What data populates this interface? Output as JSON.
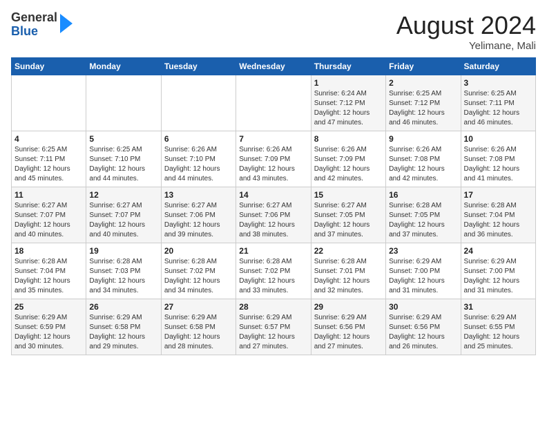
{
  "header": {
    "logo": {
      "general": "General",
      "blue": "Blue"
    },
    "month": "August 2024",
    "location": "Yelimane, Mali"
  },
  "weekdays": [
    "Sunday",
    "Monday",
    "Tuesday",
    "Wednesday",
    "Thursday",
    "Friday",
    "Saturday"
  ],
  "weeks": [
    [
      {
        "day": "",
        "sunrise": "",
        "sunset": "",
        "daylight": ""
      },
      {
        "day": "",
        "sunrise": "",
        "sunset": "",
        "daylight": ""
      },
      {
        "day": "",
        "sunrise": "",
        "sunset": "",
        "daylight": ""
      },
      {
        "day": "",
        "sunrise": "",
        "sunset": "",
        "daylight": ""
      },
      {
        "day": "1",
        "sunrise": "Sunrise: 6:24 AM",
        "sunset": "Sunset: 7:12 PM",
        "daylight": "Daylight: 12 hours and 47 minutes."
      },
      {
        "day": "2",
        "sunrise": "Sunrise: 6:25 AM",
        "sunset": "Sunset: 7:12 PM",
        "daylight": "Daylight: 12 hours and 46 minutes."
      },
      {
        "day": "3",
        "sunrise": "Sunrise: 6:25 AM",
        "sunset": "Sunset: 7:11 PM",
        "daylight": "Daylight: 12 hours and 46 minutes."
      }
    ],
    [
      {
        "day": "4",
        "sunrise": "Sunrise: 6:25 AM",
        "sunset": "Sunset: 7:11 PM",
        "daylight": "Daylight: 12 hours and 45 minutes."
      },
      {
        "day": "5",
        "sunrise": "Sunrise: 6:25 AM",
        "sunset": "Sunset: 7:10 PM",
        "daylight": "Daylight: 12 hours and 44 minutes."
      },
      {
        "day": "6",
        "sunrise": "Sunrise: 6:26 AM",
        "sunset": "Sunset: 7:10 PM",
        "daylight": "Daylight: 12 hours and 44 minutes."
      },
      {
        "day": "7",
        "sunrise": "Sunrise: 6:26 AM",
        "sunset": "Sunset: 7:09 PM",
        "daylight": "Daylight: 12 hours and 43 minutes."
      },
      {
        "day": "8",
        "sunrise": "Sunrise: 6:26 AM",
        "sunset": "Sunset: 7:09 PM",
        "daylight": "Daylight: 12 hours and 42 minutes."
      },
      {
        "day": "9",
        "sunrise": "Sunrise: 6:26 AM",
        "sunset": "Sunset: 7:08 PM",
        "daylight": "Daylight: 12 hours and 42 minutes."
      },
      {
        "day": "10",
        "sunrise": "Sunrise: 6:26 AM",
        "sunset": "Sunset: 7:08 PM",
        "daylight": "Daylight: 12 hours and 41 minutes."
      }
    ],
    [
      {
        "day": "11",
        "sunrise": "Sunrise: 6:27 AM",
        "sunset": "Sunset: 7:07 PM",
        "daylight": "Daylight: 12 hours and 40 minutes."
      },
      {
        "day": "12",
        "sunrise": "Sunrise: 6:27 AM",
        "sunset": "Sunset: 7:07 PM",
        "daylight": "Daylight: 12 hours and 40 minutes."
      },
      {
        "day": "13",
        "sunrise": "Sunrise: 6:27 AM",
        "sunset": "Sunset: 7:06 PM",
        "daylight": "Daylight: 12 hours and 39 minutes."
      },
      {
        "day": "14",
        "sunrise": "Sunrise: 6:27 AM",
        "sunset": "Sunset: 7:06 PM",
        "daylight": "Daylight: 12 hours and 38 minutes."
      },
      {
        "day": "15",
        "sunrise": "Sunrise: 6:27 AM",
        "sunset": "Sunset: 7:05 PM",
        "daylight": "Daylight: 12 hours and 37 minutes."
      },
      {
        "day": "16",
        "sunrise": "Sunrise: 6:28 AM",
        "sunset": "Sunset: 7:05 PM",
        "daylight": "Daylight: 12 hours and 37 minutes."
      },
      {
        "day": "17",
        "sunrise": "Sunrise: 6:28 AM",
        "sunset": "Sunset: 7:04 PM",
        "daylight": "Daylight: 12 hours and 36 minutes."
      }
    ],
    [
      {
        "day": "18",
        "sunrise": "Sunrise: 6:28 AM",
        "sunset": "Sunset: 7:04 PM",
        "daylight": "Daylight: 12 hours and 35 minutes."
      },
      {
        "day": "19",
        "sunrise": "Sunrise: 6:28 AM",
        "sunset": "Sunset: 7:03 PM",
        "daylight": "Daylight: 12 hours and 34 minutes."
      },
      {
        "day": "20",
        "sunrise": "Sunrise: 6:28 AM",
        "sunset": "Sunset: 7:02 PM",
        "daylight": "Daylight: 12 hours and 34 minutes."
      },
      {
        "day": "21",
        "sunrise": "Sunrise: 6:28 AM",
        "sunset": "Sunset: 7:02 PM",
        "daylight": "Daylight: 12 hours and 33 minutes."
      },
      {
        "day": "22",
        "sunrise": "Sunrise: 6:28 AM",
        "sunset": "Sunset: 7:01 PM",
        "daylight": "Daylight: 12 hours and 32 minutes."
      },
      {
        "day": "23",
        "sunrise": "Sunrise: 6:29 AM",
        "sunset": "Sunset: 7:00 PM",
        "daylight": "Daylight: 12 hours and 31 minutes."
      },
      {
        "day": "24",
        "sunrise": "Sunrise: 6:29 AM",
        "sunset": "Sunset: 7:00 PM",
        "daylight": "Daylight: 12 hours and 31 minutes."
      }
    ],
    [
      {
        "day": "25",
        "sunrise": "Sunrise: 6:29 AM",
        "sunset": "Sunset: 6:59 PM",
        "daylight": "Daylight: 12 hours and 30 minutes."
      },
      {
        "day": "26",
        "sunrise": "Sunrise: 6:29 AM",
        "sunset": "Sunset: 6:58 PM",
        "daylight": "Daylight: 12 hours and 29 minutes."
      },
      {
        "day": "27",
        "sunrise": "Sunrise: 6:29 AM",
        "sunset": "Sunset: 6:58 PM",
        "daylight": "Daylight: 12 hours and 28 minutes."
      },
      {
        "day": "28",
        "sunrise": "Sunrise: 6:29 AM",
        "sunset": "Sunset: 6:57 PM",
        "daylight": "Daylight: 12 hours and 27 minutes."
      },
      {
        "day": "29",
        "sunrise": "Sunrise: 6:29 AM",
        "sunset": "Sunset: 6:56 PM",
        "daylight": "Daylight: 12 hours and 27 minutes."
      },
      {
        "day": "30",
        "sunrise": "Sunrise: 6:29 AM",
        "sunset": "Sunset: 6:56 PM",
        "daylight": "Daylight: 12 hours and 26 minutes."
      },
      {
        "day": "31",
        "sunrise": "Sunrise: 6:29 AM",
        "sunset": "Sunset: 6:55 PM",
        "daylight": "Daylight: 12 hours and 25 minutes."
      }
    ]
  ]
}
